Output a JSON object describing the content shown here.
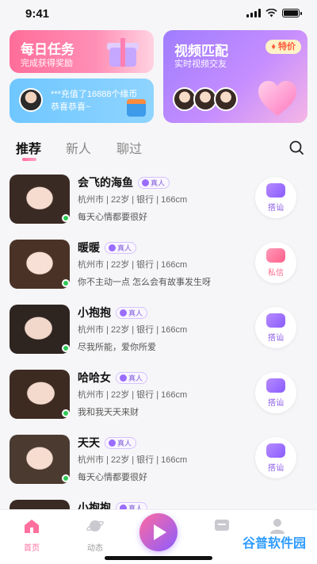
{
  "status": {
    "time": "9:41"
  },
  "promo": {
    "daily": {
      "title": "每日任务",
      "subtitle": "完成获得奖励"
    },
    "recharge": {
      "text_line1": "***充值了16888个缘币",
      "text_line2": "恭喜恭喜~"
    },
    "video": {
      "title": "视频匹配",
      "subtitle": "实时视频交友",
      "badge": "特价"
    }
  },
  "tabs": [
    {
      "label": "推荐"
    },
    {
      "label": "新人"
    },
    {
      "label": "聊过"
    }
  ],
  "verified_label": "真人",
  "feed": [
    {
      "name": "会飞的海鱼",
      "meta": "杭州市 | 22岁 | 银行 | 166cm",
      "bio": "每天心情都要很好",
      "action": "搭讪",
      "action_icon": "heart-message-icon"
    },
    {
      "name": "暖暖",
      "meta": "杭州市 | 22岁 | 银行 | 166cm",
      "bio": "你不主动一点 怎么会有故事发生呀",
      "action": "私信",
      "action_icon": "chat-message-icon"
    },
    {
      "name": "小抱抱",
      "meta": "杭州市 | 22岁 | 银行 | 166cm",
      "bio": "尽我所能，爱你所爱",
      "action": "搭讪",
      "action_icon": "heart-message-icon"
    },
    {
      "name": "哈哈女",
      "meta": "杭州市 | 22岁 | 银行 | 166cm",
      "bio": "我和我天天来财",
      "action": "搭讪",
      "action_icon": "heart-message-icon"
    },
    {
      "name": "天天",
      "meta": "杭州市 | 22岁 | 银行 | 166cm",
      "bio": "每天心情都要很好",
      "action": "搭讪",
      "action_icon": "heart-message-icon"
    },
    {
      "name": "小抱抱",
      "meta": "",
      "bio": "",
      "action": "",
      "action_icon": ""
    }
  ],
  "nav": {
    "home": "首页",
    "dynamic": "动态",
    "watermark": "谷普软件园"
  },
  "colors": {
    "accent_pink": "#ff6f9e",
    "accent_purple": "#8b5cff",
    "online": "#2dcb56"
  }
}
